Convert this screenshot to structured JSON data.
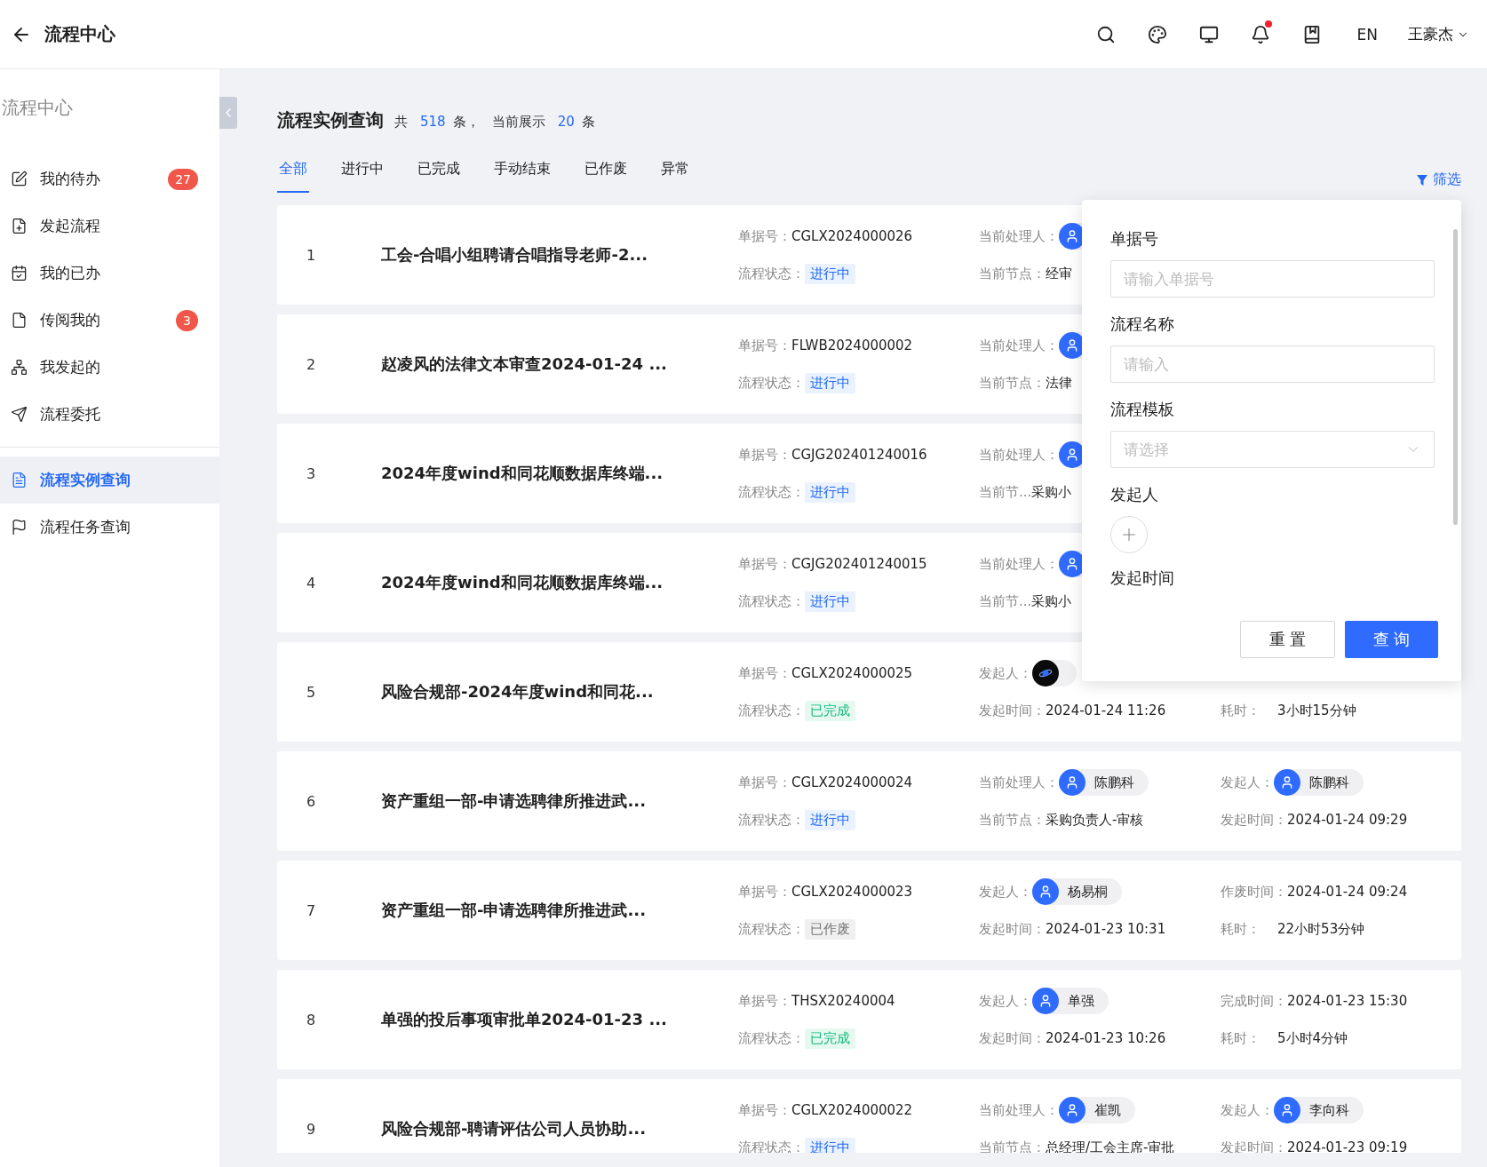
{
  "header": {
    "title": "流程中心",
    "lang": "EN",
    "user": "王豪杰",
    "notification_dot": true
  },
  "sidebar": {
    "title": "流程中心",
    "groups": [
      [
        {
          "label": "我的待办",
          "badge": "27",
          "selected": false
        },
        {
          "label": "发起流程",
          "selected": false
        },
        {
          "label": "我的已办",
          "selected": false
        },
        {
          "label": "传阅我的",
          "badge": "3",
          "selected": false
        },
        {
          "label": "我发起的",
          "selected": false
        },
        {
          "label": "流程委托",
          "selected": false
        }
      ],
      [
        {
          "label": "流程实例查询",
          "selected": true
        },
        {
          "label": "流程任务查询",
          "selected": false
        }
      ]
    ]
  },
  "page": {
    "title": "流程实例查询",
    "summary": [
      {
        "kind": "text",
        "text": "共"
      },
      {
        "kind": "number",
        "text": "518"
      },
      {
        "kind": "text",
        "text": "条，"
      },
      {
        "kind": "text",
        "text": "当前展示"
      },
      {
        "kind": "number",
        "text": "20"
      },
      {
        "kind": "text",
        "text": "条"
      }
    ]
  },
  "tabs": [
    {
      "label": "全部",
      "selected": true
    },
    {
      "label": "进行中",
      "selected": false
    },
    {
      "label": "已完成",
      "selected": false
    },
    {
      "label": "手动结束",
      "selected": false
    },
    {
      "label": "已作废",
      "selected": false
    },
    {
      "label": "异常",
      "selected": false
    }
  ],
  "filter_link": "筛选",
  "rows": [
    {
      "index": "1",
      "title": "工会-合唱小组聘请合唱指导老师-2...",
      "doc_label": "单据号：",
      "doc_no": "CGLX2024000026",
      "status_label": "流程状态：",
      "status": {
        "text": "进行中",
        "kind": "running"
      },
      "col3": {
        "top": {
          "kind": "person",
          "label": "当前处理人："
        },
        "bottom": {
          "kind": "text",
          "label": "当前节点：",
          "value": "经审"
        }
      }
    },
    {
      "index": "2",
      "title": "赵凌风的法律文本审查2024-01-24 ...",
      "doc_label": "单据号：",
      "doc_no": "FLWB2024000002",
      "status_label": "流程状态：",
      "status": {
        "text": "进行中",
        "kind": "running"
      },
      "col3": {
        "top": {
          "kind": "person",
          "label": "当前处理人："
        },
        "bottom": {
          "kind": "text",
          "label": "当前节点：",
          "value": "法律"
        }
      }
    },
    {
      "index": "3",
      "title": "2024年度wind和同花顺数据库终端...",
      "doc_label": "单据号：",
      "doc_no": "CGJG202401240016",
      "status_label": "流程状态：",
      "status": {
        "text": "进行中",
        "kind": "running"
      },
      "col3": {
        "top": {
          "kind": "person",
          "label": "当前处理人："
        },
        "bottom": {
          "kind": "text",
          "label": "当前节...",
          "value": "采购小"
        }
      }
    },
    {
      "index": "4",
      "title": "2024年度wind和同花顺数据库终端...",
      "doc_label": "单据号：",
      "doc_no": "CGJG202401240015",
      "status_label": "流程状态：",
      "status": {
        "text": "进行中",
        "kind": "running"
      },
      "col3": {
        "top": {
          "kind": "person",
          "label": "当前处理人："
        },
        "bottom": {
          "kind": "text",
          "label": "当前节...",
          "value": "采购小"
        }
      }
    },
    {
      "index": "5",
      "title": "风险合规部-2024年度wind和同花...",
      "doc_label": "单据号：",
      "doc_no": "CGLX2024000025",
      "status_label": "流程状态：",
      "status": {
        "text": "已完成",
        "kind": "done"
      },
      "col3": {
        "top": {
          "kind": "planet",
          "label": "发起人："
        },
        "bottom": {
          "kind": "text",
          "label": "发起时间：",
          "value": "2024-01-24 11:26"
        }
      },
      "col4": {
        "bottom": {
          "kind": "text",
          "label": "耗时：",
          "value": "3小时15分钟"
        }
      }
    },
    {
      "index": "6",
      "title": "资产重组一部-申请选聘律所推进武...",
      "doc_label": "单据号：",
      "doc_no": "CGLX2024000024",
      "status_label": "流程状态：",
      "status": {
        "text": "进行中",
        "kind": "running"
      },
      "col3": {
        "top": {
          "kind": "person",
          "label": "当前处理人：",
          "name": "陈鹏科"
        },
        "bottom": {
          "kind": "text",
          "label": "当前节点：",
          "value": "采购负责人-审核"
        }
      },
      "col4": {
        "top": {
          "kind": "person",
          "label": "发起人：",
          "name": "陈鹏科"
        },
        "bottom": {
          "kind": "text",
          "label": "发起时间：",
          "value": "2024-01-24 09:29"
        }
      }
    },
    {
      "index": "7",
      "title": "资产重组一部-申请选聘律所推进武...",
      "doc_label": "单据号：",
      "doc_no": "CGLX2024000023",
      "status_label": "流程状态：",
      "status": {
        "text": "已作废",
        "kind": "void"
      },
      "col3": {
        "top": {
          "kind": "person",
          "label": "发起人：",
          "name": "杨易桐"
        },
        "bottom": {
          "kind": "text",
          "label": "发起时间：",
          "value": "2024-01-23 10:31"
        }
      },
      "col4": {
        "top": {
          "kind": "text",
          "label": "作废时间：",
          "value": "2024-01-24 09:24"
        },
        "bottom": {
          "kind": "text",
          "label": "耗时：",
          "value": "22小时53分钟"
        }
      }
    },
    {
      "index": "8",
      "title": "单强的投后事项审批单2024-01-23 ...",
      "doc_label": "单据号：",
      "doc_no": "THSX20240004",
      "status_label": "流程状态：",
      "status": {
        "text": "已完成",
        "kind": "done"
      },
      "col3": {
        "top": {
          "kind": "person",
          "label": "发起人：",
          "name": "单强"
        },
        "bottom": {
          "kind": "text",
          "label": "发起时间：",
          "value": "2024-01-23 10:26"
        }
      },
      "col4": {
        "top": {
          "kind": "text",
          "label": "完成时间：",
          "value": "2024-01-23 15:30"
        },
        "bottom": {
          "kind": "text",
          "label": "耗时：",
          "value": "5小时4分钟"
        }
      }
    },
    {
      "index": "9",
      "title": "风险合规部-聘请评估公司人员协助...",
      "doc_label": "单据号：",
      "doc_no": "CGLX2024000022",
      "status_label": "流程状态：",
      "status": {
        "text": "进行中",
        "kind": "running"
      },
      "col3": {
        "top": {
          "kind": "person",
          "label": "当前处理人：",
          "name": "崔凯"
        },
        "bottom": {
          "kind": "text",
          "label": "当前节点：",
          "value": "总经理/工会主席-审批"
        }
      },
      "col4": {
        "top": {
          "kind": "person",
          "label": "发起人：",
          "name": "李向科"
        },
        "bottom": {
          "kind": "text",
          "label": "发起时间：",
          "value": "2024-01-23 09:19"
        }
      }
    }
  ],
  "filter_panel": {
    "fields": [
      {
        "kind": "input",
        "label": "单据号",
        "placeholder": "请输入单据号"
      },
      {
        "kind": "input",
        "label": "流程名称",
        "placeholder": "请输入"
      },
      {
        "kind": "select",
        "label": "流程模板",
        "placeholder": "请选择"
      },
      {
        "kind": "people",
        "label": "发起人"
      },
      {
        "kind": "heading",
        "label": "发起时间"
      }
    ],
    "buttons": [
      {
        "label": "重 置",
        "kind": "secondary"
      },
      {
        "label": "查 询",
        "kind": "primary"
      }
    ]
  }
}
